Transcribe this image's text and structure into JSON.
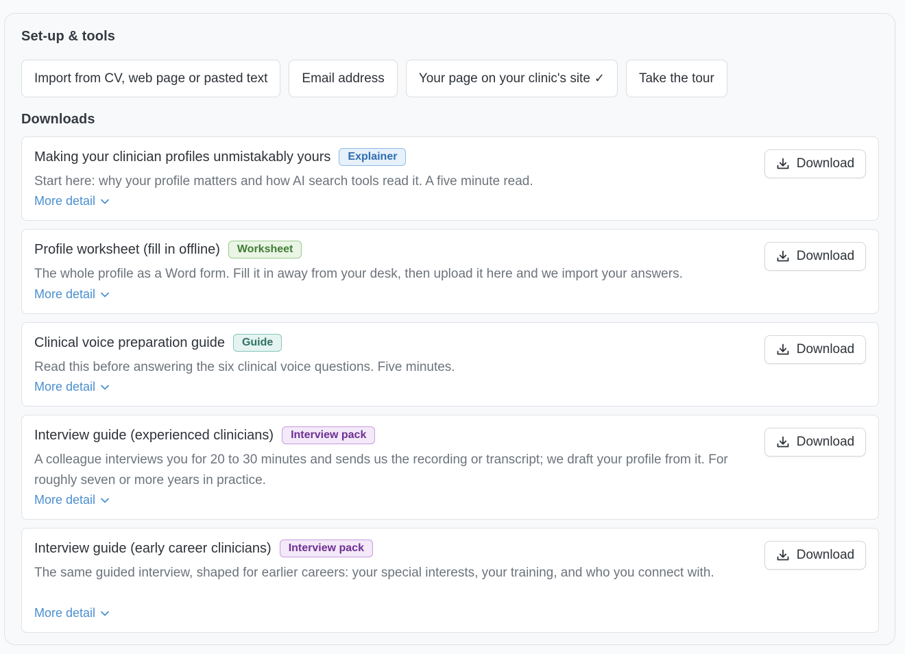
{
  "setup": {
    "title": "Set-up & tools",
    "buttons": [
      {
        "label": "Import from CV, web page or pasted text"
      },
      {
        "label": "Email address"
      },
      {
        "label": "Your page on your clinic's site",
        "check": "✓"
      },
      {
        "label": "Take the tour"
      }
    ]
  },
  "downloads": {
    "title": "Downloads",
    "more_label": "More detail",
    "download_label": "Download",
    "items": [
      {
        "title": "Making your clinician profiles unmistakably yours",
        "badge": "Explainer",
        "badge_colors": {
          "bg": "#e6f1fc",
          "border": "#8fbbe6",
          "text": "#2f6db0"
        },
        "description": "Start here: why your profile matters and how AI search tools read it. A five minute read."
      },
      {
        "title": "Profile worksheet (fill in offline)",
        "badge": "Worksheet",
        "badge_colors": {
          "bg": "#eaf5e6",
          "border": "#98cc8c",
          "text": "#3f7d33"
        },
        "description": "The whole profile as a Word form. Fill it in away from your desk, then upload it here and we import your answers."
      },
      {
        "title": "Clinical voice preparation guide",
        "badge": "Guide",
        "badge_colors": {
          "bg": "#e5f4f1",
          "border": "#86c6b8",
          "text": "#2e7263"
        },
        "description": "Read this before answering the six clinical voice questions. Five minutes."
      },
      {
        "title": "Interview guide (experienced clinicians)",
        "badge": "Interview pack",
        "badge_colors": {
          "bg": "#f3e9f8",
          "border": "#c89ae0",
          "text": "#6d2f93"
        },
        "description": "A colleague interviews you for 20 to 30 minutes and sends us the recording or transcript; we draft your profile from it. For roughly seven or more years in practice."
      },
      {
        "title": "Interview guide (early career clinicians)",
        "badge": "Interview pack",
        "badge_colors": {
          "bg": "#f3e9f8",
          "border": "#c89ae0",
          "text": "#6d2f93"
        },
        "description": "The same guided interview, shaped for earlier careers: your special interests, your training, and who you connect with."
      }
    ]
  },
  "icons": {
    "download": "download-icon",
    "chevron": "chevron-down-icon"
  },
  "colors": {
    "link": "#4a8fcf",
    "text": "#2d3238",
    "muted": "#6c737b"
  }
}
